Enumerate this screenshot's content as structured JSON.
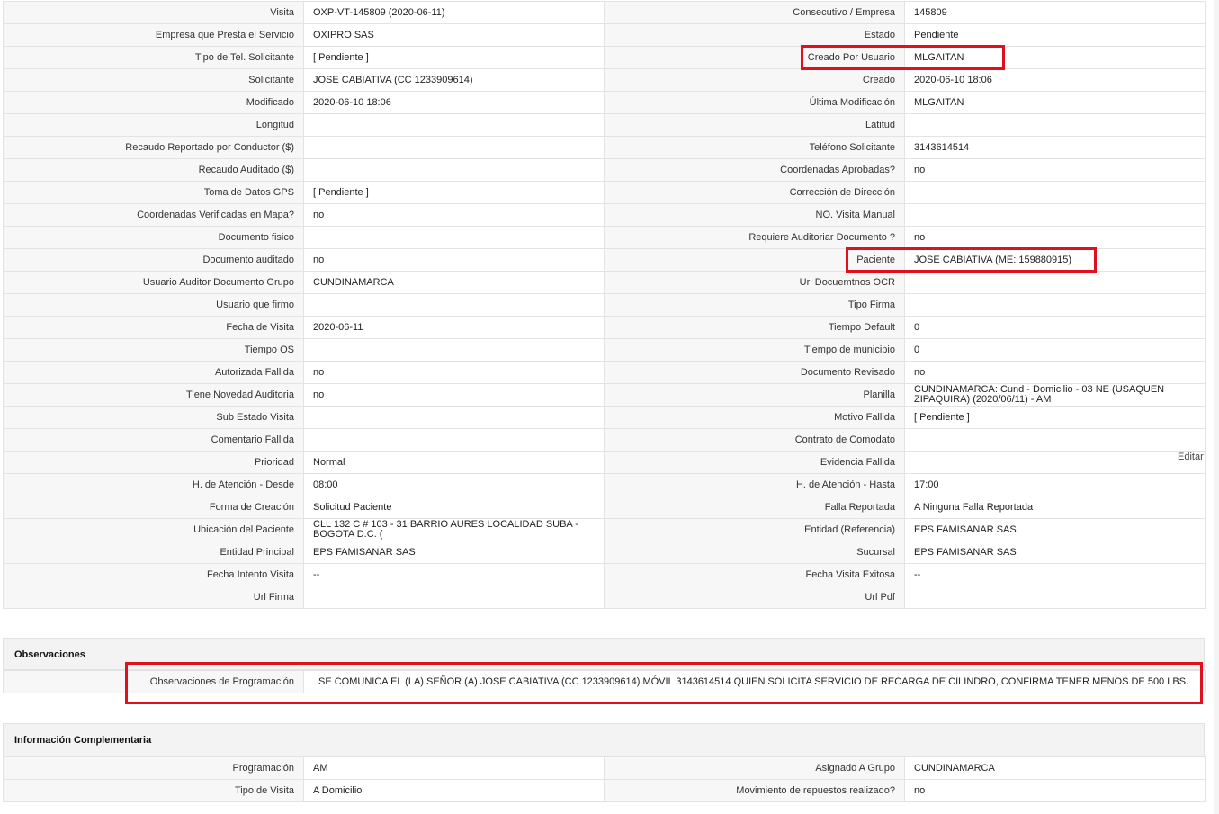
{
  "main_rows": [
    {
      "l1": "Visita",
      "v1": "OXP-VT-145809 (2020-06-11)",
      "l2": "Consecutivo / Empresa",
      "v2": "145809"
    },
    {
      "l1": "Empresa que Presta el Servicio",
      "v1": "OXIPRO SAS",
      "l2": "Estado",
      "v2": "Pendiente"
    },
    {
      "l1": "Tipo de Tel. Solicitante",
      "v1": "[ Pendiente ]",
      "l2": "Creado Por Usuario",
      "v2": "MLGAITAN"
    },
    {
      "l1": "Solicitante",
      "v1": "JOSE CABIATIVA (CC 1233909614)",
      "l2": "Creado",
      "v2": "2020-06-10 18:06"
    },
    {
      "l1": "Modificado",
      "v1": "2020-06-10 18:06",
      "l2": "Última Modificación",
      "v2": " MLGAITAN"
    },
    {
      "l1": "Longitud",
      "v1": "",
      "l2": "Latitud",
      "v2": ""
    },
    {
      "l1": "Recaudo Reportado por Conductor ($)",
      "v1": "",
      "l2": "Teléfono Solicitante",
      "v2": "3143614514"
    },
    {
      "l1": "Recaudo Auditado ($)",
      "v1": "",
      "l2": "Coordenadas Aprobadas?",
      "v2": " no"
    },
    {
      "l1": "Toma de Datos GPS",
      "v1": "[ Pendiente ]",
      "l2": "Corrección de Dirección",
      "v2": ""
    },
    {
      "l1": "Coordenadas Verificadas en Mapa?",
      "v1": " no",
      "l2": "NO. Visita Manual",
      "v2": ""
    },
    {
      "l1": "Documento fisico",
      "v1": "",
      "l2": "Requiere Auditoriar Documento ?",
      "v2": " no"
    },
    {
      "l1": "Documento auditado",
      "v1": " no",
      "l2": "Paciente",
      "v2": "JOSE CABIATIVA (ME: 159880915)"
    },
    {
      "l1": "Usuario Auditor Documento Grupo",
      "v1": "CUNDINAMARCA",
      "l2": "Url Docuemtnos OCR",
      "v2": ""
    },
    {
      "l1": "Usuario que firmo",
      "v1": "",
      "l2": "Tipo Firma",
      "v2": ""
    },
    {
      "l1": "Fecha de Visita",
      "v1": " 2020-06-11",
      "l2": "Tiempo Default",
      "v2": "0"
    },
    {
      "l1": "Tiempo OS",
      "v1": "",
      "l2": "Tiempo de municipio",
      "v2": "0"
    },
    {
      "l1": "Autorizada Fallida",
      "v1": " no",
      "l2": "Documento Revisado",
      "v2": " no"
    },
    {
      "l1": "Tiene Novedad Auditoria",
      "v1": " no",
      "l2": "Planilla",
      "v2": "CUNDINAMARCA: Cund - Domicilio - 03 NE (USAQUEN ZIPAQUIRA) (2020/06/11) - AM"
    },
    {
      "l1": "Sub Estado Visita",
      "v1": "",
      "l2": "Motivo Fallida",
      "v2": "[ Pendiente ]"
    },
    {
      "l1": "Comentario Fallida",
      "v1": "",
      "l2": "Contrato de Comodato",
      "v2": ""
    },
    {
      "l1": "Prioridad",
      "v1": "Normal",
      "l2": "Evidencia Fallida",
      "v2": ""
    },
    {
      "l1": "H. de Atención - Desde",
      "v1": "08:00",
      "l2": "H. de Atención - Hasta",
      "v2": " 17:00"
    },
    {
      "l1": "Forma de Creación",
      "v1": "Solicitud Paciente",
      "l2": "Falla Reportada",
      "v2": "A Ninguna Falla Reportada"
    },
    {
      "l1": "Ubicación del Paciente",
      "v1": "CLL 132 C # 103 - 31 BARRIO AURES LOCALIDAD SUBA - BOGOTA D.C. (",
      "l2": "Entidad (Referencia)",
      "v2": "EPS FAMISANAR SAS"
    },
    {
      "l1": "Entidad Principal",
      "v1": "EPS FAMISANAR SAS",
      "l2": "Sucursal",
      "v2": "EPS FAMISANAR SAS"
    },
    {
      "l1": "Fecha Intento Visita",
      "v1": " --",
      "l2": "Fecha Visita Exitosa",
      "v2": " --"
    },
    {
      "l1": "Url Firma",
      "v1": "",
      "l2": "Url Pdf",
      "v2": ""
    }
  ],
  "edit_link": "Editar",
  "observaciones": {
    "title": "Observaciones",
    "label": "Observaciones de Programación",
    "value": "SE COMUNICA EL (LA) SEÑOR (A) JOSE CABIATIVA (CC 1233909614) MÓVIL 3143614514 QUIEN SOLICITA SERVICIO DE RECARGA DE CILINDRO, CONFIRMA TENER MENOS DE 500 LBS."
  },
  "info": {
    "title": "Información Complementaria",
    "rows": [
      {
        "l1": "Programación",
        "v1": "AM",
        "l2": "Asignado A Grupo",
        "v2": "CUNDINAMARCA"
      },
      {
        "l1": "Tipo de Visita",
        "v1": "A Domicilio",
        "l2": "Movimiento de repuestos realizado?",
        "v2": " no"
      }
    ]
  },
  "highlight_color": "#e0101f"
}
